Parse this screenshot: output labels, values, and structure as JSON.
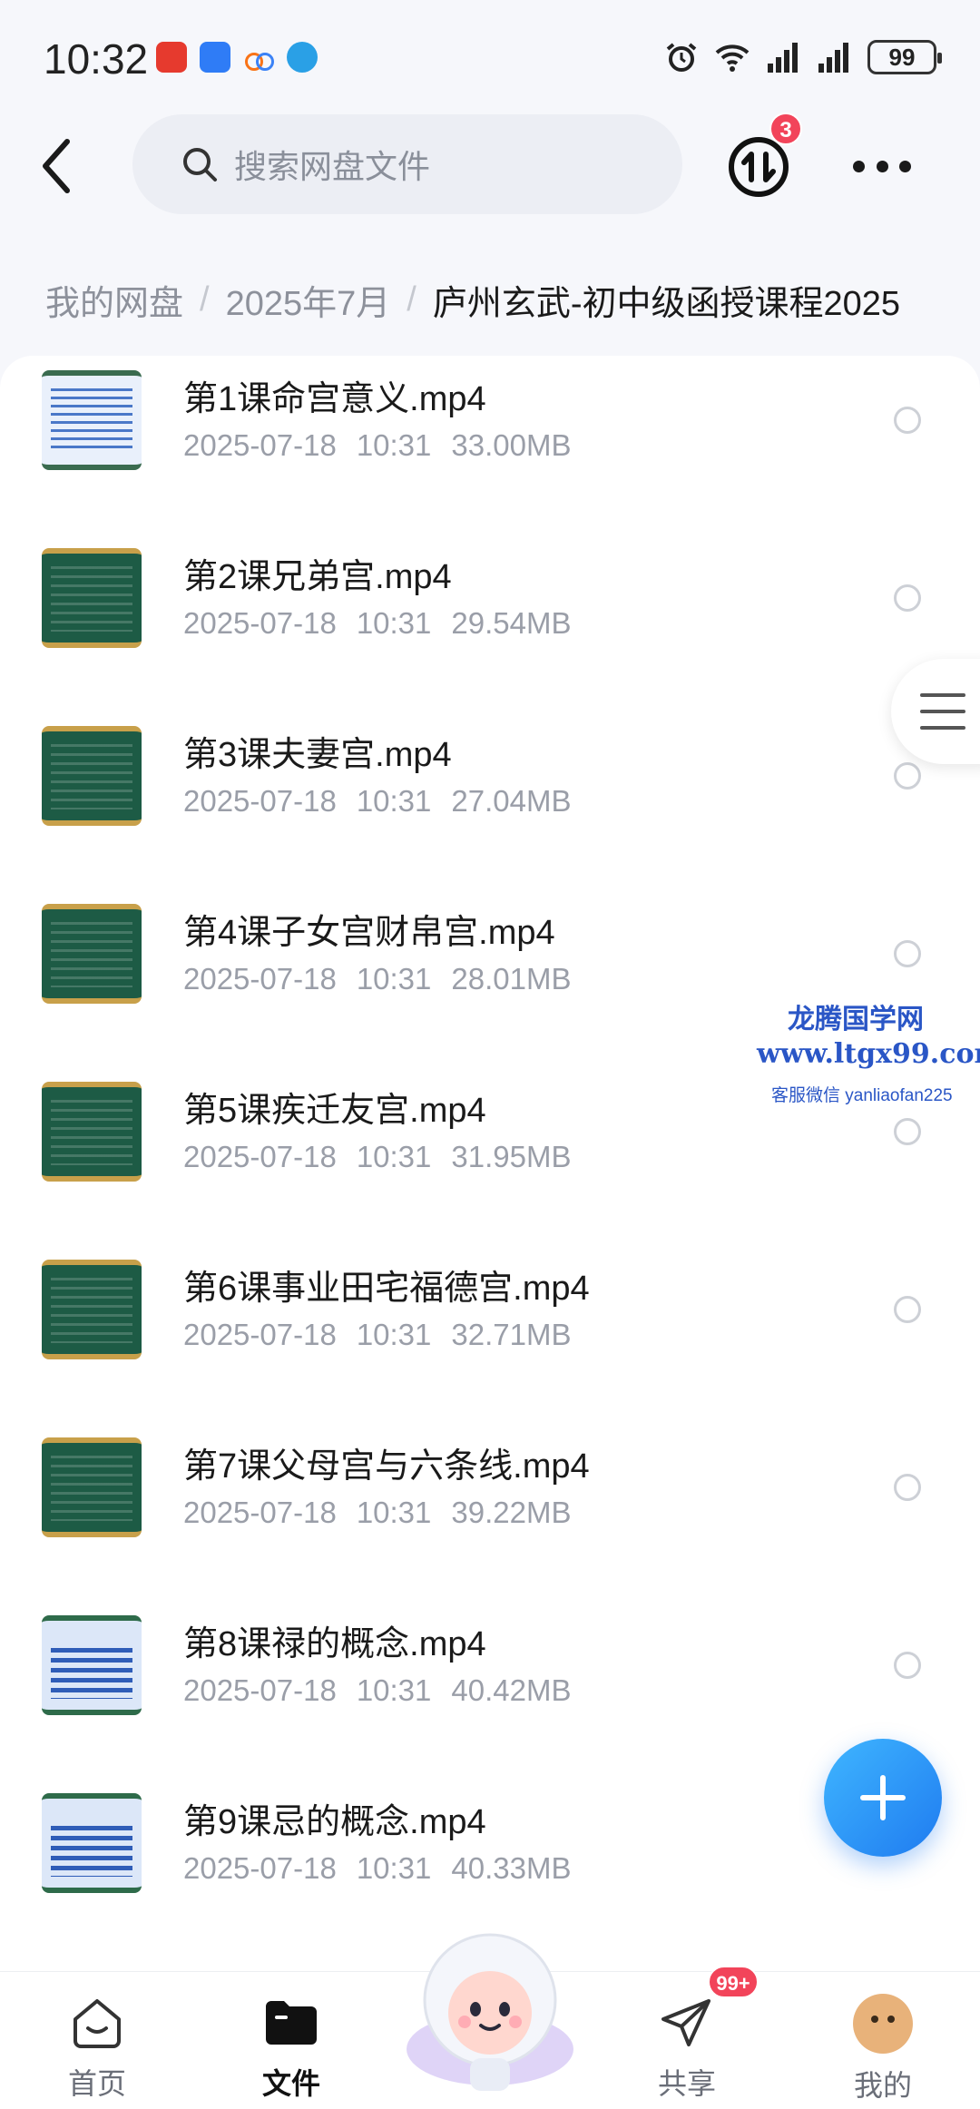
{
  "status_bar": {
    "time": "10:32",
    "battery": "99"
  },
  "toolbar": {
    "search_placeholder": "搜索网盘文件",
    "transfer_badge": "3"
  },
  "breadcrumb": [
    "我的网盘",
    "2025年7月",
    "庐州玄武-初中级函授课程2025"
  ],
  "files": [
    {
      "name": "第1课命宫意义.mp4",
      "date": "2025-07-18",
      "time": "10:31",
      "size": "33.00MB",
      "thumb": "table"
    },
    {
      "name": "第2课兄弟宫.mp4",
      "date": "2025-07-18",
      "time": "10:31",
      "size": "29.54MB",
      "thumb": "board"
    },
    {
      "name": "第3课夫妻宫.mp4",
      "date": "2025-07-18",
      "time": "10:31",
      "size": "27.04MB",
      "thumb": "board"
    },
    {
      "name": "第4课子女宫财帛宫.mp4",
      "date": "2025-07-18",
      "time": "10:31",
      "size": "28.01MB",
      "thumb": "board"
    },
    {
      "name": "第5课疾迁友宫.mp4",
      "date": "2025-07-18",
      "time": "10:31",
      "size": "31.95MB",
      "thumb": "board"
    },
    {
      "name": "第6课事业田宅福德宫.mp4",
      "date": "2025-07-18",
      "time": "10:31",
      "size": "32.71MB",
      "thumb": "board"
    },
    {
      "name": "第7课父母宫与六条线.mp4",
      "date": "2025-07-18",
      "time": "10:31",
      "size": "39.22MB",
      "thumb": "board"
    },
    {
      "name": "第8课禄的概念.mp4",
      "date": "2025-07-18",
      "time": "10:31",
      "size": "40.42MB",
      "thumb": "blue"
    },
    {
      "name": "第9课忌的概念.mp4",
      "date": "2025-07-18",
      "time": "10:31",
      "size": "40.33MB",
      "thumb": "blue"
    }
  ],
  "watermark": {
    "name": "龙腾国学网",
    "url": "www.ltgx99.com",
    "contact": "客服微信 yanliaofan225"
  },
  "bottom_nav": [
    {
      "label": "首页",
      "icon": "home-icon"
    },
    {
      "label": "文件",
      "icon": "folder-icon",
      "active": true
    },
    {
      "label": "共享",
      "icon": "paper-plane-icon",
      "badge": "99+"
    },
    {
      "label": "我的",
      "icon": "avatar-icon"
    }
  ],
  "colors": {
    "accent": "#1f7bf0",
    "badge": "#f2445a",
    "text_secondary": "#9a9ea8"
  }
}
